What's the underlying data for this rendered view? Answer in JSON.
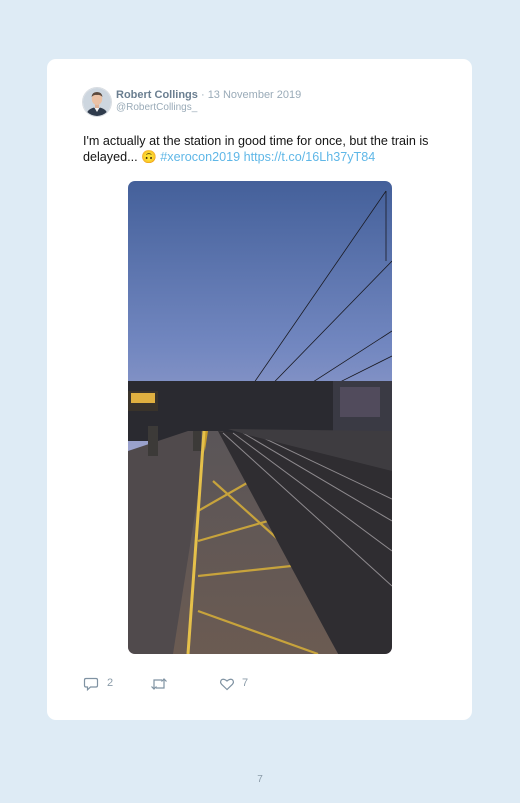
{
  "tweet": {
    "author_name": "Robert Collings",
    "separator": "·",
    "date": "13 November 2019",
    "handle": "@RobertCollings_",
    "text_plain": "I'm actually at the station in good time for once, but the train is delayed... 🙃 ",
    "hashtag": "#xerocon2019",
    "link": "https://t.co/16Lh37yT84",
    "image_alt": "railway station platform at dusk"
  },
  "actions": {
    "reply_count": "2",
    "retweet_count": "",
    "like_count": "7"
  },
  "page": {
    "number": "7"
  },
  "colors": {
    "background": "#deebf5",
    "card": "#ffffff",
    "link": "#5fb7e7",
    "muted": "#8a9ba8"
  },
  "icons": [
    "reply-icon",
    "retweet-icon",
    "like-icon"
  ]
}
